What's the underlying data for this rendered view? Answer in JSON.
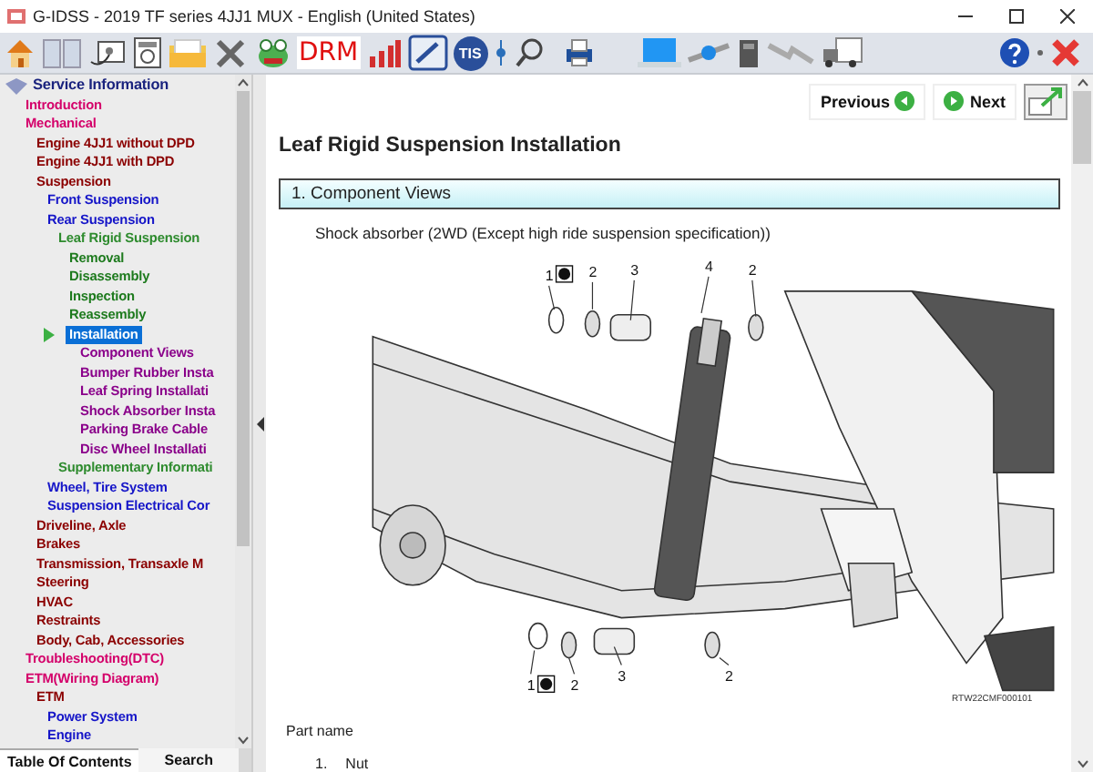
{
  "window": {
    "title": "G-IDSS - 2019 TF series 4JJ1 MUX - English (United States)"
  },
  "toolbar": {
    "drm_label": "DRM",
    "tis_label": "TIS"
  },
  "sidebar": {
    "tree": [
      {
        "label": "Service Information",
        "selected": false,
        "children": [
          {
            "label": "Introduction",
            "selected": false
          },
          {
            "label": "Mechanical",
            "selected": false,
            "children": [
              {
                "label": "Engine 4JJ1 without DPD",
                "selected": false
              },
              {
                "label": "Engine 4JJ1 with DPD",
                "selected": false
              },
              {
                "label": "Suspension",
                "selected": false,
                "children": [
                  {
                    "label": "Front Suspension",
                    "selected": false
                  },
                  {
                    "label": "Rear Suspension",
                    "selected": false,
                    "children": [
                      {
                        "label": "Leaf Rigid Suspension",
                        "selected": false,
                        "children": [
                          {
                            "label": "Removal",
                            "selected": false
                          },
                          {
                            "label": "Disassembly",
                            "selected": false
                          },
                          {
                            "label": "Inspection",
                            "selected": false
                          },
                          {
                            "label": "Reassembly",
                            "selected": false
                          },
                          {
                            "label": "Installation",
                            "selected": true,
                            "children": [
                              {
                                "label": "Component Views",
                                "selected": false
                              },
                              {
                                "label": "Bumper Rubber Insta",
                                "selected": false
                              },
                              {
                                "label": "Leaf Spring Installati",
                                "selected": false
                              },
                              {
                                "label": "Shock Absorber Insta",
                                "selected": false
                              },
                              {
                                "label": "Parking Brake Cable",
                                "selected": false
                              },
                              {
                                "label": "Disc Wheel Installati",
                                "selected": false
                              }
                            ]
                          }
                        ]
                      },
                      {
                        "label": "Supplementary Informati",
                        "selected": false
                      }
                    ]
                  },
                  {
                    "label": "Wheel, Tire System",
                    "selected": false
                  },
                  {
                    "label": "Suspension Electrical Cor",
                    "selected": false
                  }
                ]
              },
              {
                "label": "Driveline, Axle",
                "selected": false
              },
              {
                "label": "Brakes",
                "selected": false
              },
              {
                "label": "Transmission, Transaxle M",
                "selected": false
              },
              {
                "label": "Steering",
                "selected": false
              },
              {
                "label": "HVAC",
                "selected": false
              },
              {
                "label": "Restraints",
                "selected": false
              },
              {
                "label": "Body, Cab, Accessories",
                "selected": false
              }
            ]
          },
          {
            "label": "Troubleshooting(DTC)",
            "selected": false
          },
          {
            "label": "ETM(Wiring Diagram)",
            "selected": false,
            "children": [
              {
                "label": "ETM",
                "selected": false,
                "children": [
                  {
                    "label": "Power System",
                    "selected": false
                  },
                  {
                    "label": "Engine",
                    "selected": false
                  }
                ]
              }
            ]
          }
        ]
      }
    ],
    "tabs": [
      {
        "label": "Table Of Contents",
        "selected": true
      },
      {
        "label": "Search",
        "selected": false
      }
    ]
  },
  "content": {
    "nav": {
      "previous": "Previous",
      "next": "Next"
    },
    "heading": "Leaf Rigid Suspension Installation",
    "section": "1. Component Views",
    "caption": "Shock absorber (2WD (Except high ride suspension specification))",
    "figure": {
      "callouts": [
        "1",
        "2",
        "3",
        "4",
        "2",
        "1",
        "2",
        "3",
        "2"
      ],
      "figure_id": "RTW22CMF000101"
    },
    "part_name_label": "Part name",
    "parts": [
      {
        "number": "1.",
        "name": "Nut"
      }
    ]
  }
}
